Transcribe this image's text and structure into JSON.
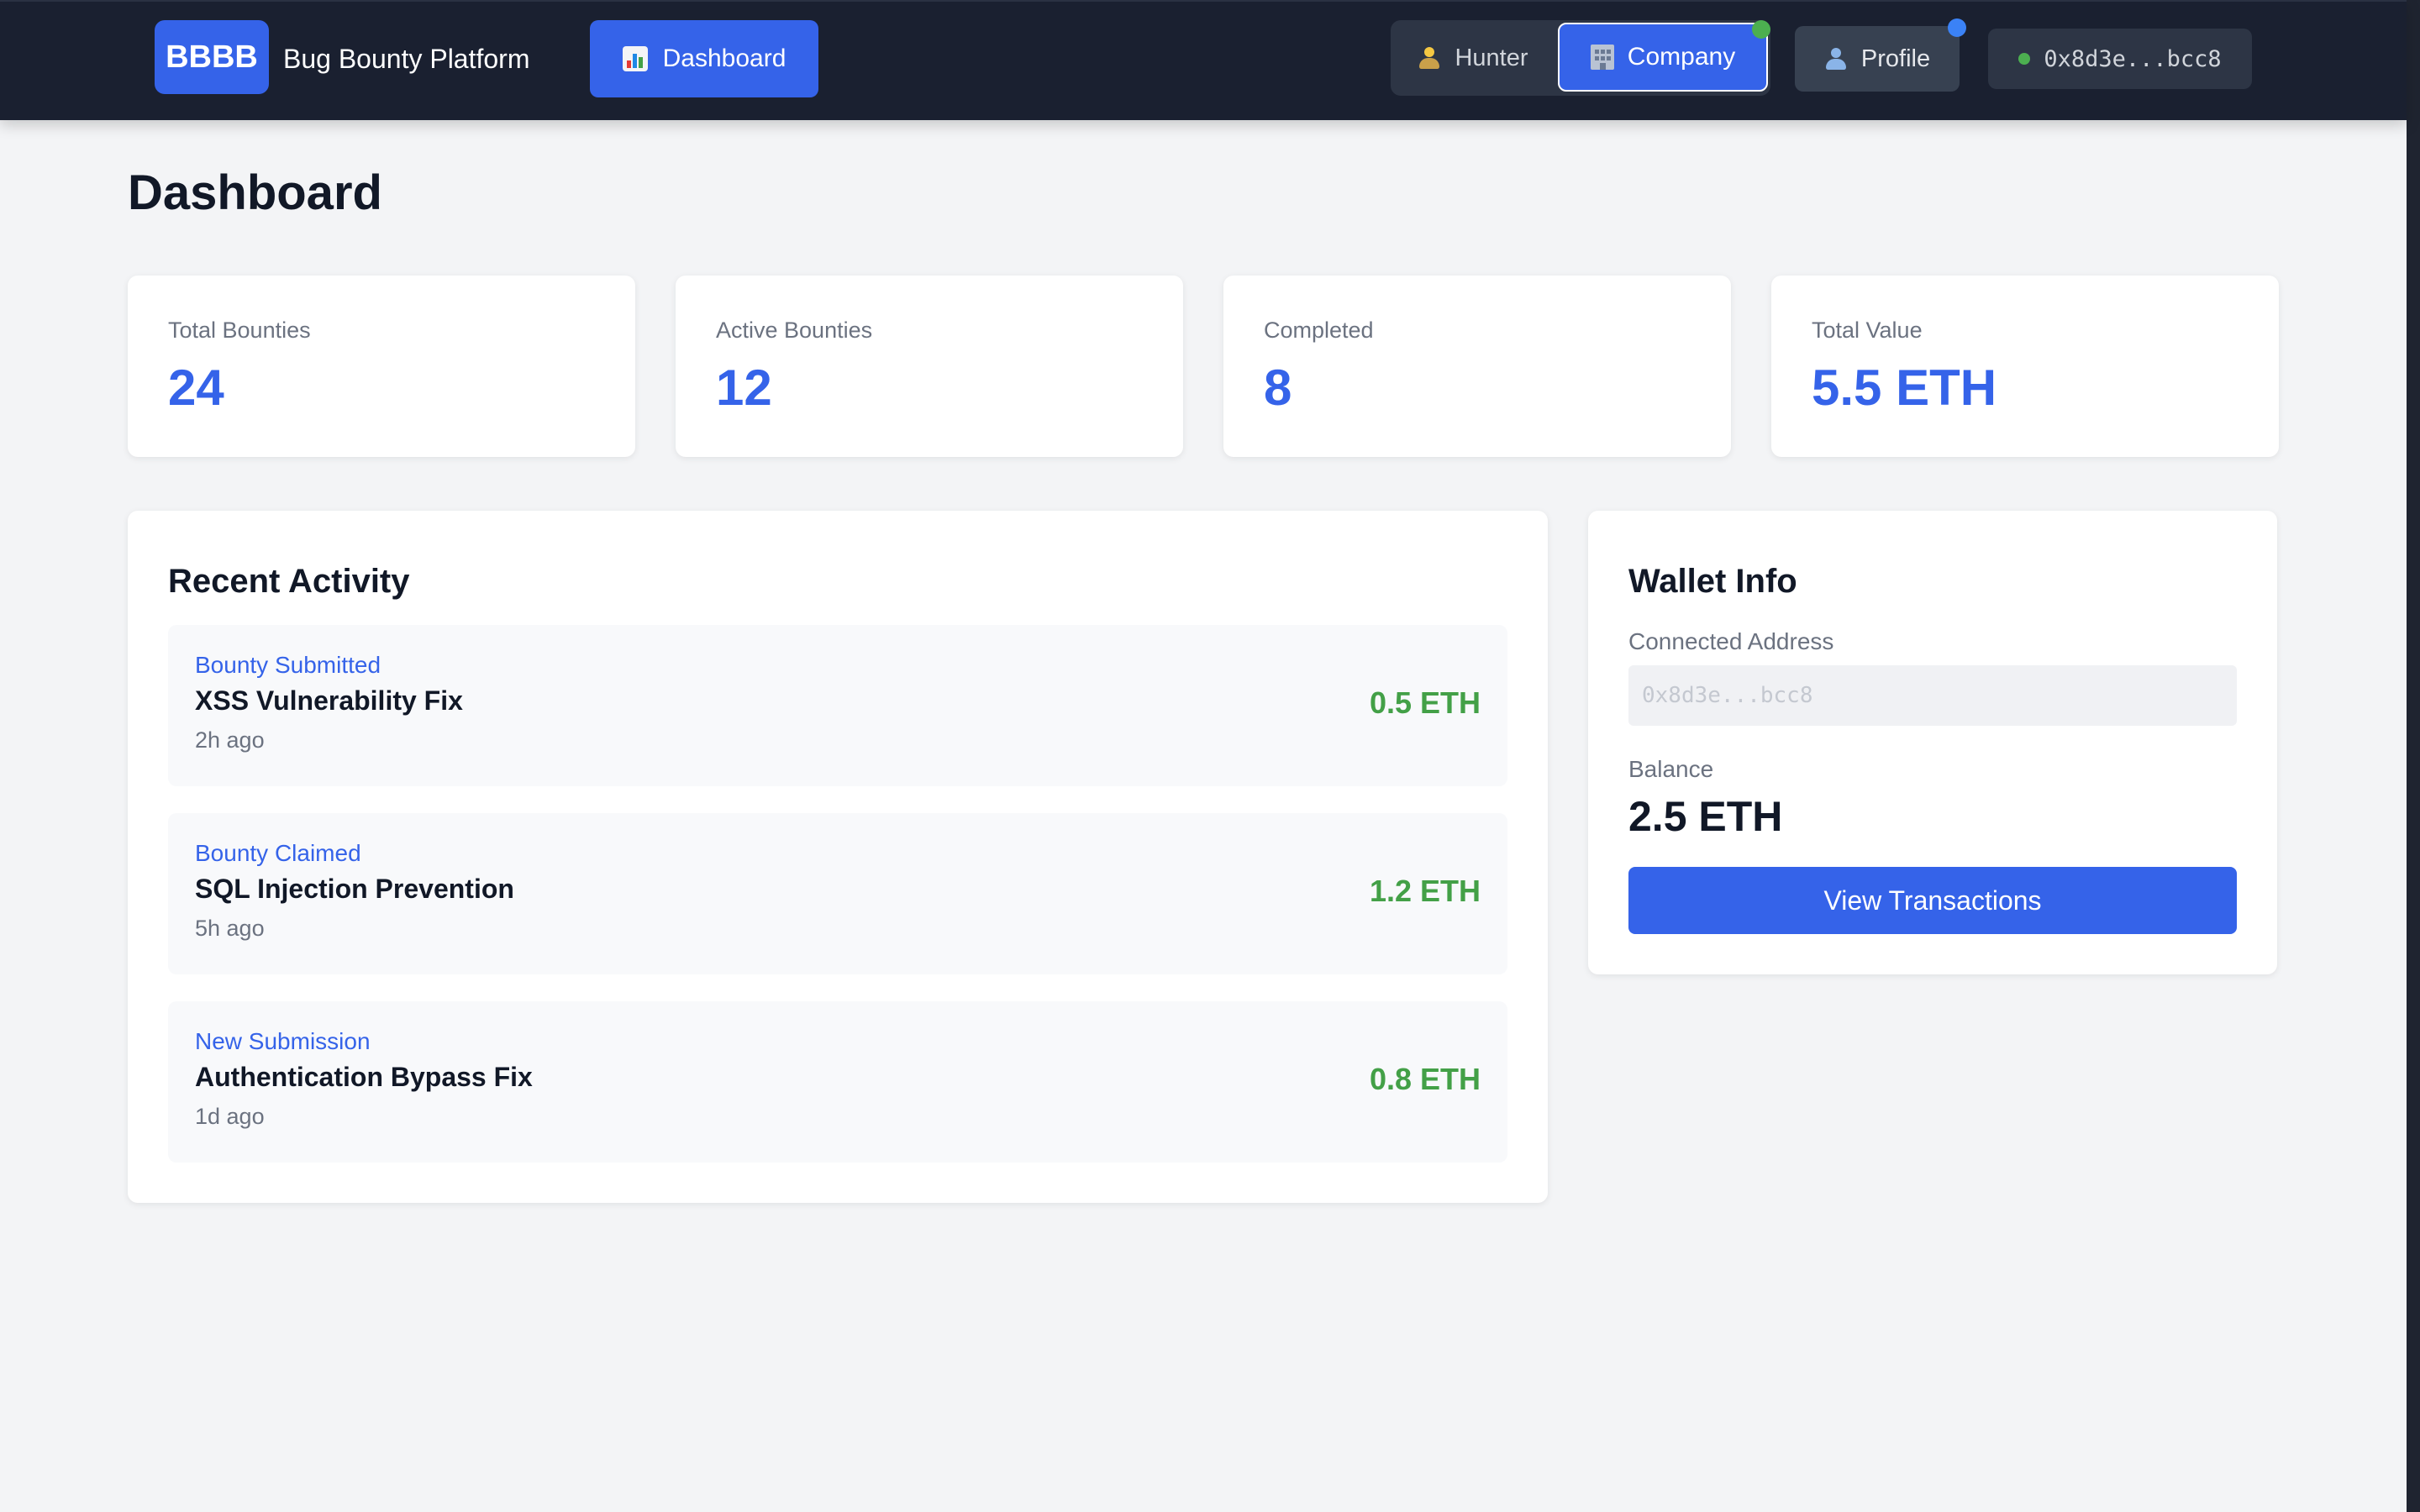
{
  "navbar": {
    "logo": "BBBB",
    "app_name": "Bug Bounty Platform",
    "dashboard_label": "Dashboard",
    "roles": {
      "hunter": "Hunter",
      "company": "Company",
      "active": "Company"
    },
    "profile_label": "Profile",
    "wallet_short": "0x8d3e...bcc8",
    "icons": {
      "dashboard": "bar-chart-icon",
      "hunter": "detective-icon",
      "company": "building-icon",
      "profile": "user-icon",
      "wallet_status": "connected-dot"
    },
    "status_colors": {
      "company_indicator": "#4caf50",
      "profile_indicator": "#3b82f6",
      "wallet_connected": "#4caf50"
    }
  },
  "page": {
    "title": "Dashboard"
  },
  "stats": [
    {
      "label": "Total Bounties",
      "value": "24"
    },
    {
      "label": "Active Bounties",
      "value": "12"
    },
    {
      "label": "Completed",
      "value": "8"
    },
    {
      "label": "Total Value",
      "value": "5.5 ETH"
    }
  ],
  "recent_activity": {
    "title": "Recent Activity",
    "items": [
      {
        "type": "Bounty Submitted",
        "title": "XSS Vulnerability Fix",
        "time": "2h ago",
        "amount": "0.5 ETH"
      },
      {
        "type": "Bounty Claimed",
        "title": "SQL Injection Prevention",
        "time": "5h ago",
        "amount": "1.2 ETH"
      },
      {
        "type": "New Submission",
        "title": "Authentication Bypass Fix",
        "time": "1d ago",
        "amount": "0.8 ETH"
      }
    ]
  },
  "wallet": {
    "title": "Wallet Info",
    "address_label": "Connected Address",
    "address_value": "0x8d3e...bcc8",
    "balance_label": "Balance",
    "balance_value": "2.5 ETH",
    "view_transactions_label": "View Transactions"
  },
  "colors": {
    "accent": "#3563e9",
    "navbar_bg": "#1a2030",
    "amount_green": "#43a047",
    "page_bg": "#f3f4f6"
  }
}
